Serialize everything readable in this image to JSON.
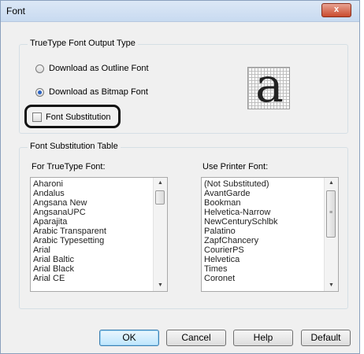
{
  "window": {
    "title": "Font",
    "close_label": "x"
  },
  "output_type": {
    "legend": "TrueType Font Output Type",
    "options": [
      {
        "label": "Download as Outline Font",
        "selected": false
      },
      {
        "label": "Download as Bitmap Font",
        "selected": true
      }
    ],
    "substitution_label": "Font Substitution",
    "substitution_checked": false,
    "preview_glyph": "a"
  },
  "sub_table": {
    "legend": "Font Substitution Table",
    "truetype_label": "For TrueType Font:",
    "printer_label": "Use Printer Font:",
    "truetype_fonts": [
      "Aharoni",
      "Andalus",
      "Angsana New",
      "AngsanaUPC",
      "Aparajita",
      "Arabic Transparent",
      "Arabic Typesetting",
      "Arial",
      "Arial Baltic",
      "Arial Black",
      "Arial CE"
    ],
    "printer_fonts": [
      "(Not Substituted)",
      "AvantGarde",
      "Bookman",
      "Helvetica-Narrow",
      "NewCenturySchlbk",
      "Palatino",
      "ZapfChancery",
      "CourierPS",
      "Helvetica",
      "Times",
      "Coronet"
    ]
  },
  "buttons": {
    "ok": "OK",
    "cancel": "Cancel",
    "help": "Help",
    "default": "Default"
  },
  "icons": {
    "up": "scroll-up-arrow-icon",
    "down": "scroll-down-arrow-icon"
  }
}
